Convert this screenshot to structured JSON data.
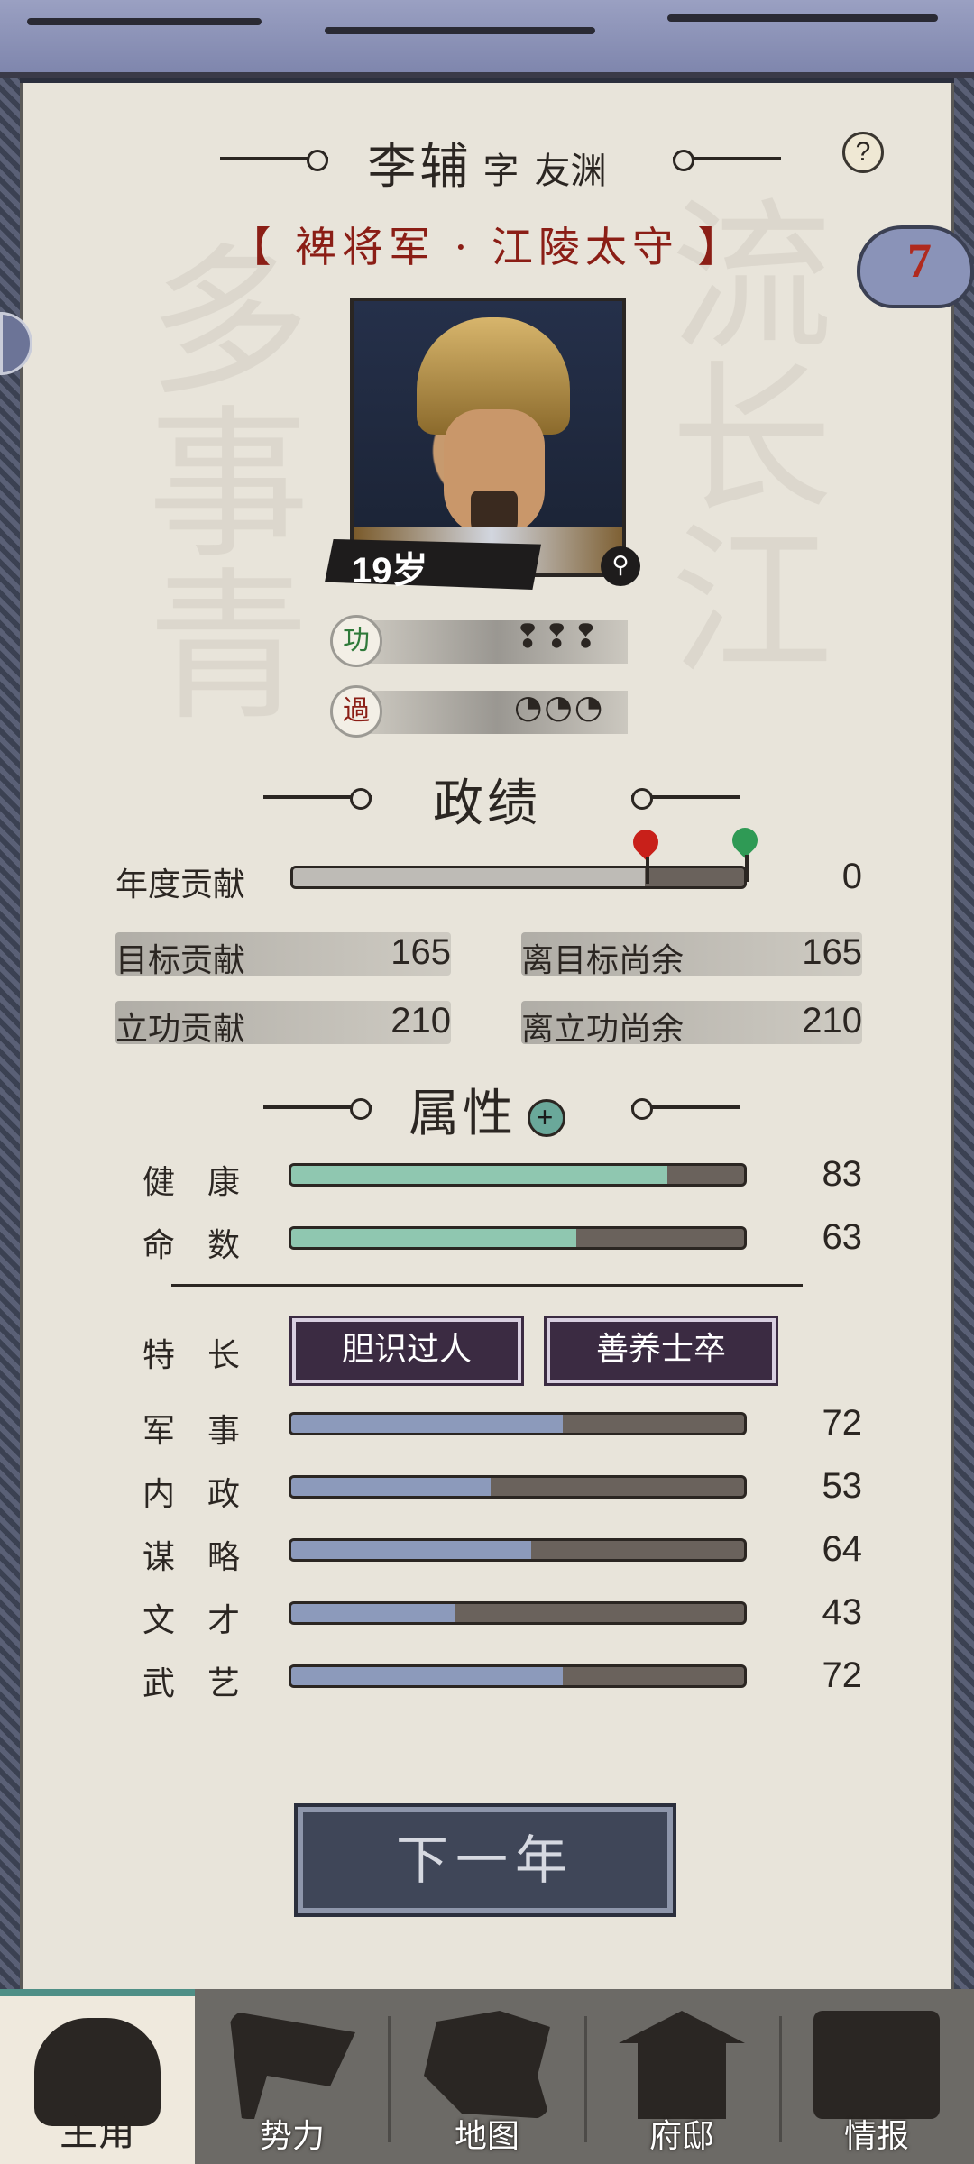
{
  "header": {
    "name": "李辅",
    "courtesy_prefix": "字",
    "courtesy_name": "友渊",
    "help_icon": "?",
    "title": "【 裨将军 · 江陵太守 】",
    "badge_count": "7"
  },
  "portrait": {
    "age": "19岁"
  },
  "merit": {
    "icon_label": "功",
    "marks": "❢❢❢",
    "count": 3
  },
  "demerit": {
    "icon_label": "過",
    "marks": "◔◔◔",
    "count": 3
  },
  "performance": {
    "title": "政绩",
    "annual_label": "年度贡献",
    "annual_value": "0",
    "annual_progress": 0.0,
    "target_label": "目标贡献",
    "target_value": "165",
    "remain_target_label": "离目标尚余",
    "remain_target_value": "165",
    "merit_label": "立功贡献",
    "merit_value": "210",
    "remain_merit_label": "离立功尚余",
    "remain_merit_value": "210"
  },
  "attributes": {
    "title": "属性",
    "plus_icon": "+",
    "health": {
      "label": "健　康",
      "value": "83",
      "fraction": 0.83
    },
    "fate": {
      "label": "命　数",
      "value": "63",
      "fraction": 0.63
    },
    "traits_label": "特　长",
    "traits": [
      "胆识过人",
      "善养士卒"
    ],
    "stats": [
      {
        "label": "军　事",
        "value": "72",
        "fraction": 0.6
      },
      {
        "label": "内　政",
        "value": "53",
        "fraction": 0.44
      },
      {
        "label": "谋　略",
        "value": "64",
        "fraction": 0.53
      },
      {
        "label": "文　才",
        "value": "43",
        "fraction": 0.36
      },
      {
        "label": "武　艺",
        "value": "72",
        "fraction": 0.6
      }
    ]
  },
  "actions": {
    "next_year": "下一年"
  },
  "nav": [
    {
      "label": "主角",
      "icon": "hero-icon",
      "active": true
    },
    {
      "label": "势力",
      "icon": "flag-icon",
      "active": false
    },
    {
      "label": "地图",
      "icon": "map-icon",
      "active": false
    },
    {
      "label": "府邸",
      "icon": "mansion-icon",
      "active": false
    },
    {
      "label": "情报",
      "icon": "scroll-icon",
      "active": false
    }
  ],
  "colors": {
    "health_fill": "#8fc7b0",
    "stat_fill": "#8c9abb",
    "title_red": "#8b1e16",
    "trait_bg": "#3b2b42"
  }
}
